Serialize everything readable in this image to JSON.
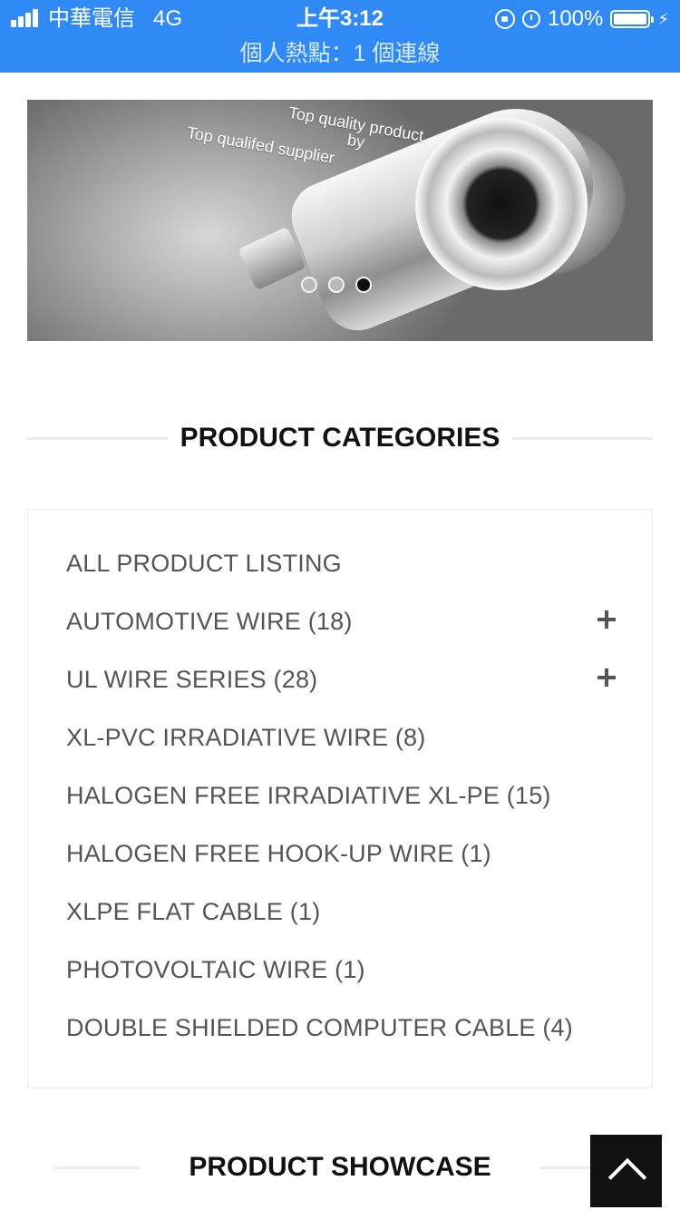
{
  "status_bar": {
    "carrier": "中華電信",
    "network": "4G",
    "time": "上午3:12",
    "battery": "100%",
    "hotspot": "個人熱點：1 個連線",
    "background_color": "#2f8af5"
  },
  "banner": {
    "texts": [
      "Top quality product",
      "by",
      "Top qualifed supplier"
    ],
    "slides": 3,
    "active_slide": 3
  },
  "categories": {
    "title": "PRODUCT CATEGORIES",
    "items": [
      {
        "label": "ALL PRODUCT LISTING",
        "expandable": false
      },
      {
        "label": "AUTOMOTIVE WIRE (18)",
        "expandable": true
      },
      {
        "label": "UL WIRE SERIES (28)",
        "expandable": true
      },
      {
        "label": "XL-PVC IRRADIATIVE WIRE (8)",
        "expandable": false
      },
      {
        "label": "HALOGEN FREE IRRADIATIVE XL-PE (15)",
        "expandable": false
      },
      {
        "label": "HALOGEN FREE HOOK-UP WIRE (1)",
        "expandable": false
      },
      {
        "label": "XLPE FLAT CABLE (1)",
        "expandable": false
      },
      {
        "label": "PHOTOVOLTAIC WIRE (1)",
        "expandable": false
      },
      {
        "label": "DOUBLE SHIELDED COMPUTER CABLE (4)",
        "expandable": false
      }
    ]
  },
  "showcase": {
    "title": "PRODUCT SHOWCASE"
  },
  "icons": {
    "back_to_top": "chevron-up-icon",
    "expand": "plus-icon"
  }
}
